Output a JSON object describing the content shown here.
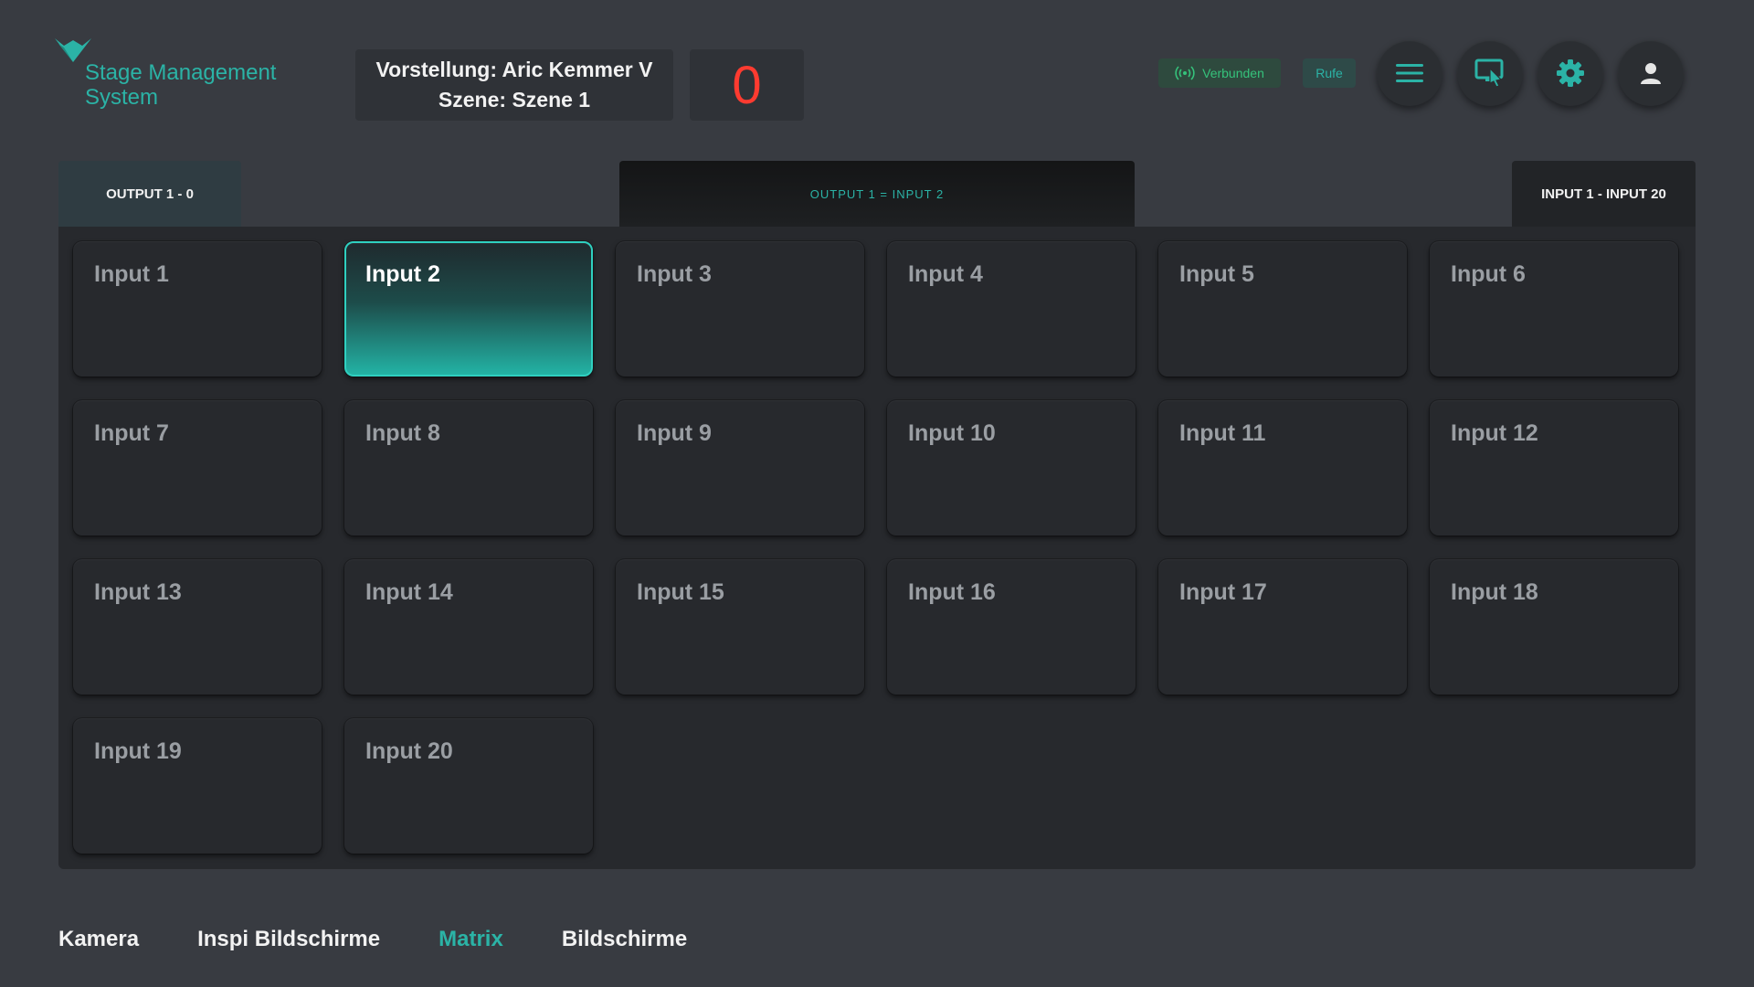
{
  "app": {
    "logo_text_line1": "Stage Management",
    "logo_text_line2": "System",
    "brand_color": "#2bb3a6"
  },
  "header": {
    "performance_label": "Vorstellung:",
    "performance_value": "Aric Kemmer V",
    "scene_label": "Szene:",
    "scene_value": "Szene 1",
    "counter": "0",
    "counter_color": "#ff3b30",
    "connection_status": "Verbunden",
    "call_button": "Rufe",
    "icons": [
      "menu-icon",
      "touch-screen-icon",
      "gear-icon",
      "user-icon"
    ]
  },
  "matrix": {
    "output_tab": "OUTPUT 1 - 0",
    "routing_status": "OUTPUT 1  =  INPUT 2",
    "input_range_tab": "INPUT 1 - INPUT 20",
    "selected_input": "Input 2",
    "inputs": [
      "Input 1",
      "Input 2",
      "Input 3",
      "Input 4",
      "Input 5",
      "Input 6",
      "Input 7",
      "Input 8",
      "Input 9",
      "Input 10",
      "Input 11",
      "Input 12",
      "Input 13",
      "Input 14",
      "Input 15",
      "Input 16",
      "Input 17",
      "Input 18",
      "Input 19",
      "Input 20"
    ]
  },
  "bottom_nav": {
    "items": [
      "Kamera",
      "Inspi Bildschirme",
      "Matrix",
      "Bildschirme"
    ],
    "active": "Matrix"
  }
}
